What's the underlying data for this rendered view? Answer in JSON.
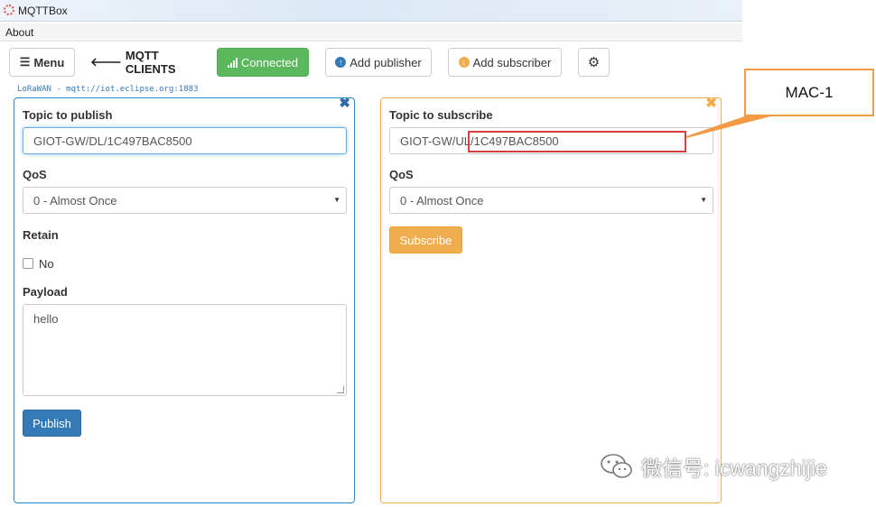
{
  "app": {
    "title": "MQTTBox"
  },
  "menubar": {
    "about": "About"
  },
  "toolbar": {
    "menu_label": "Menu",
    "clients_label": "MQTT CLIENTS",
    "connected_label": "Connected",
    "add_publisher_label": "Add publisher",
    "add_subscriber_label": "Add subscriber"
  },
  "broker": {
    "text": "LoRaWAN - mqtt://iot.eclipse.org:1883"
  },
  "publisher": {
    "topic_label": "Topic to publish",
    "topic_value": "GIOT-GW/DL/1C497BAC8500",
    "qos_label": "QoS",
    "qos_value": "0 - Almost Once",
    "retain_label": "Retain",
    "retain_option": "No",
    "payload_label": "Payload",
    "payload_value": "hello",
    "publish_label": "Publish"
  },
  "subscriber": {
    "topic_label": "Topic to subscribe",
    "topic_prefix": "GIOT-GW/UL/",
    "topic_mac": "1C497BAC8500",
    "qos_label": "QoS",
    "qos_value": "0 - Almost Once",
    "subscribe_label": "Subscribe"
  },
  "annotation": {
    "callout_text": "MAC-1"
  },
  "watermark": {
    "text": "微信号: icwangzhijie"
  },
  "colors": {
    "connected": "#5cb85c",
    "publish": "#337ab7",
    "subscribe": "#f0ad4e",
    "highlight": "#d23f3f",
    "callout": "#f29a45"
  },
  "icons": {
    "menu": "hamburger-icon",
    "back": "arrow-left-icon",
    "signal": "signal-icon",
    "add_publisher": "arrow-up-circle-icon",
    "add_subscriber": "arrow-down-circle-icon",
    "settings": "gear-icon",
    "close": "close-icon"
  }
}
